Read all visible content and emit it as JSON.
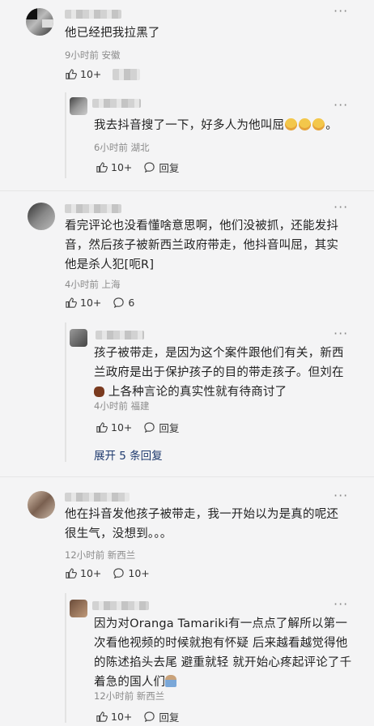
{
  "thread1": {
    "comment": {
      "text": "他已经把我拉黑了",
      "time": "9小时前",
      "location": "安徽",
      "likes": "10+"
    },
    "reply": {
      "text_a": "我去抖音搜了一下，好多人为他叫屈",
      "text_b": "。",
      "time": "6小时前",
      "location": "湖北",
      "likes": "10+",
      "reply_label": "回复"
    }
  },
  "thread2": {
    "comment": {
      "text": "看完评论也没看懂啥意思啊，他们没被抓，还能发抖音，然后孩子被新西兰政府带走，他抖音叫屈，其实他是杀人犯[呃R]",
      "time": "4小时前",
      "location": "上海",
      "likes": "10+",
      "replies_count": "6"
    },
    "reply": {
      "text_a": "孩子被带走，是因为这个案件跟他们有关，新西兰政府是出于保护孩子的目的带走孩子。但刘在",
      "text_b": "上各种言论的真实性就有待商讨了",
      "time": "4小时前",
      "location": "福建",
      "likes": "10+",
      "reply_label": "回复"
    },
    "expand_label": "展开 5 条回复"
  },
  "thread3": {
    "comment": {
      "text": "他在抖音发他孩子被带走，我一开始以为是真的呢还很生气，没想到。。。",
      "time": "12小时前",
      "location": "新西兰",
      "likes": "10+",
      "likes2": "10+"
    },
    "reply": {
      "text": "因为对Oranga Tamariki有一点点了解所以第一次看他视频的时候就抱有怀疑 后来越看越觉得他的陈述掐头去尾 避重就轻 就开始心疼起评论了千着急的国人们",
      "time": "12小时前",
      "location": "新西兰",
      "likes": "10+",
      "reply_label": "回复"
    }
  },
  "icons": {
    "more": "more-dots-icon",
    "like": "thumb-up-icon",
    "comment": "comment-bubble-icon"
  },
  "colors": {
    "meta": "#8a8a8a",
    "link": "#1f3a6e"
  }
}
